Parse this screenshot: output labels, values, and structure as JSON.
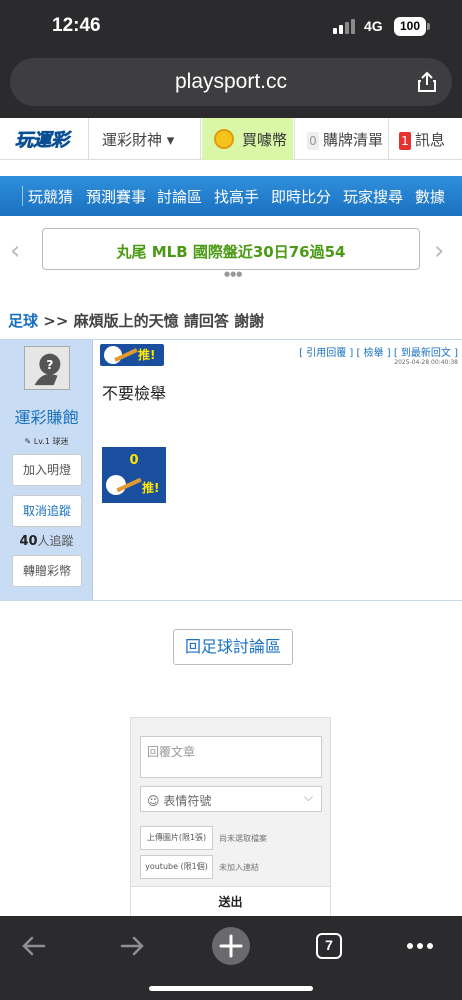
{
  "status": {
    "time": "12:46",
    "network": "4G",
    "battery": "100"
  },
  "browser": {
    "url": "playsport.cc",
    "tab_count": "7"
  },
  "site_nav": {
    "logo_text": "玩運彩",
    "god_label": "運彩財神 ▾",
    "buy_label": "買噱幣",
    "list_count": "0",
    "list_label": "購牌清單",
    "msg_count": "1",
    "msg_label": "訊息"
  },
  "menu": {
    "tabs": [
      "玩競猜",
      "預測賽事",
      "討論區",
      "找高手",
      "即時比分",
      "玩家搜尋",
      "數據"
    ]
  },
  "banner": {
    "text": "丸尾 MLB 國際盤近30日76過54"
  },
  "breadcrumb": {
    "category": "足球",
    "sep": ">>",
    "title": "麻煩版上的天憶 請回答 謝謝"
  },
  "post": {
    "user": {
      "name": "運彩賺飽",
      "level": "✎ Lv.1 球迷",
      "add_light": "加入明燈",
      "unfollow": "取消追蹤",
      "followers_num": "40",
      "followers_label": "人追蹤",
      "gift": "轉贈彩幣"
    },
    "links": "[ 引用回覆 ]  [ 檢舉 ]  [ 到最新回文 ]",
    "date": "2025-04-28 00:40:38",
    "body": "不要檢舉",
    "tui_label": "推!",
    "vote_count": "0"
  },
  "back_button": "回足球討論區",
  "reply": {
    "placeholder": "回覆文章",
    "emoji_label": "☺ 表情符號",
    "upload_btn": "上傳圖片(限1張)",
    "upload_status": "尚未選取檔案",
    "youtube_btn": "youtube (限1個)",
    "youtube_status": "未加入連結",
    "send": "送出"
  },
  "colors": {
    "brand_blue": "#1a71c0",
    "banner_green": "#4a9a14",
    "buy_bg": "#d9f7a6"
  }
}
